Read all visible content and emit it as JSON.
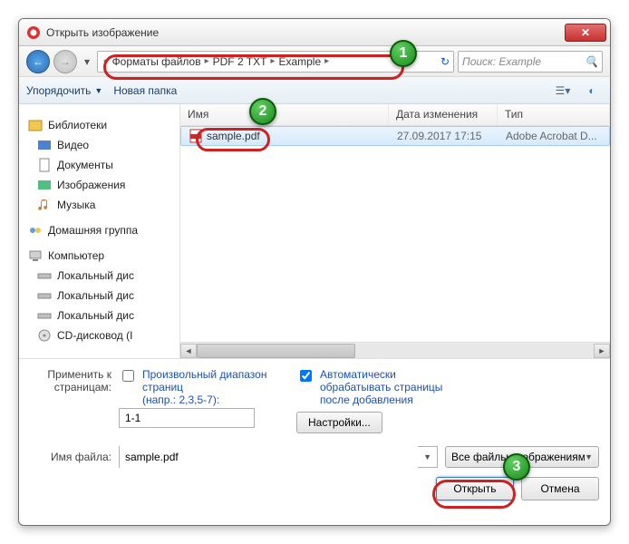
{
  "window": {
    "title": "Открыть изображение"
  },
  "nav": {
    "path": [
      "Форматы файлов",
      "PDF 2 TXT",
      "Example"
    ],
    "search_placeholder": "Поиск: Example"
  },
  "toolbar": {
    "organize": "Упорядочить",
    "newfolder": "Новая папка"
  },
  "sidebar": {
    "libraries": "Библиотеки",
    "video": "Видео",
    "documents": "Документы",
    "images": "Изображения",
    "music": "Музыка",
    "homegroup": "Домашняя группа",
    "computer": "Компьютер",
    "localdisk1": "Локальный дис",
    "localdisk2": "Локальный дис",
    "localdisk3": "Локальный дис",
    "cddrive": "CD-дисковод (I"
  },
  "columns": {
    "name": "Имя",
    "date": "Дата изменения",
    "type": "Тип"
  },
  "files": [
    {
      "name": "sample.pdf",
      "date": "27.09.2017 17:15",
      "type": "Adobe Acrobat D..."
    }
  ],
  "options": {
    "apply_to_pages": "Применить к страницам:",
    "custom_range": "Произвольный диапазон страниц",
    "range_hint": "(напр.: 2,3,5-7):",
    "range_value": "1-1",
    "auto_process": "Автоматически обрабатывать страницы после добавления",
    "settings": "Настройки..."
  },
  "filename": {
    "label": "Имя файла:",
    "value": "sample.pdf",
    "filter": "Все файлы изображениями"
  },
  "buttons": {
    "open": "Открыть",
    "cancel": "Отмена"
  },
  "callouts": {
    "c1": "1",
    "c2": "2",
    "c3": "3"
  }
}
